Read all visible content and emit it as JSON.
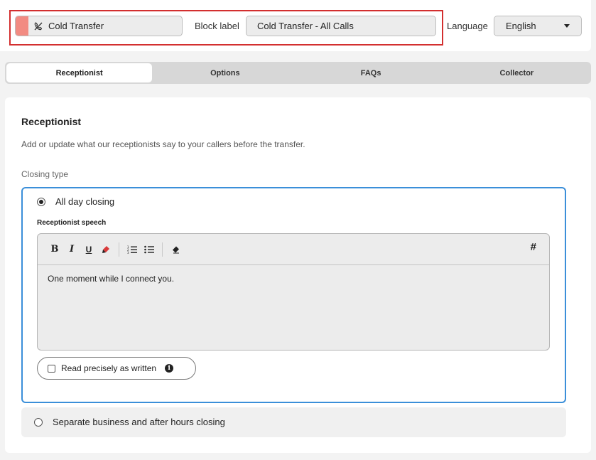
{
  "header": {
    "block_type_label": "Cold Transfer",
    "block_type_icon": "phone-slash-icon",
    "block_type_color": "#f28b82",
    "block_label_caption": "Block label",
    "block_label_value": "Cold Transfer - All Calls",
    "language_caption": "Language",
    "language_value": "English"
  },
  "tabs": [
    {
      "label": "Receptionist",
      "active": true
    },
    {
      "label": "Options",
      "active": false
    },
    {
      "label": "FAQs",
      "active": false
    },
    {
      "label": "Collector",
      "active": false
    }
  ],
  "panel": {
    "title": "Receptionist",
    "description": "Add or update what our receptionists say to your callers before the transfer.",
    "closing_type_label": "Closing type",
    "options": [
      {
        "label": "All day closing",
        "selected": true
      },
      {
        "label": "Separate business and after hours closing",
        "selected": false
      }
    ],
    "speech_label": "Receptionist speech",
    "speech_text": "One moment while I connect you.",
    "toolbar": {
      "bold": "B",
      "italic": "I",
      "underline": "U",
      "variable": "#"
    },
    "read_precisely_label": "Read precisely as written",
    "read_precisely_checked": false
  },
  "colors": {
    "accent": "#3b8fd9",
    "highlight_outline": "#d32f2f"
  }
}
